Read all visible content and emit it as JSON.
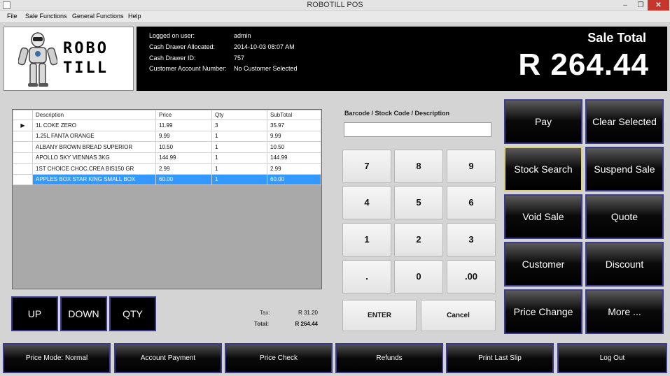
{
  "window": {
    "title": "ROBOTILL POS",
    "minimize": "–",
    "maximize": "❐",
    "close": "✕"
  },
  "menu": [
    "File",
    "Sale Functions",
    "General Functions",
    "Help"
  ],
  "logo": {
    "line1": "ROBO",
    "line2": "TILL"
  },
  "session": {
    "user_label": "Logged on user:",
    "user_value": "admin",
    "drawer_label": "Cash Drawer Allocated:",
    "drawer_value": "2014-10-03 08:07 AM",
    "drawer_id_label": "Cash Drawer ID:",
    "drawer_id_value": "757",
    "account_label": "Customer Account Number:",
    "account_value": "No Customer Selected"
  },
  "sale": {
    "label": "Sale Total",
    "total": "R 264.44"
  },
  "grid": {
    "columns": [
      "Description",
      "Price",
      "Qty",
      "SubTotal"
    ],
    "current_row_marker": "▶",
    "rows": [
      {
        "description": "1L COKE ZERO",
        "price": "11.99",
        "qty": "3",
        "subtotal": "35.97"
      },
      {
        "description": "1.25L FANTA ORANGE",
        "price": "9.99",
        "qty": "1",
        "subtotal": "9.99"
      },
      {
        "description": "ALBANY BROWN BREAD SUPERIOR",
        "price": "10.50",
        "qty": "1",
        "subtotal": "10.50"
      },
      {
        "description": "APOLLO SKY VIENNAS 3KG",
        "price": "144.99",
        "qty": "1",
        "subtotal": "144.99"
      },
      {
        "description": "1ST CHOICE CHOC.CREA BIS150 GR",
        "price": "2.99",
        "qty": "1",
        "subtotal": "2.99"
      },
      {
        "description": "APPLES BOX STAR KING SMALL BOX",
        "price": "60.00",
        "qty": "1",
        "subtotal": "60.00"
      }
    ]
  },
  "grid_buttons": {
    "up": "UP",
    "down": "DOWN",
    "qty": "QTY"
  },
  "totals": {
    "tax_label": "Tax:",
    "tax_value": "R 31.20",
    "total_label": "Total:",
    "total_value": "R 264.44"
  },
  "entry": {
    "label": "Barcode / Stock Code / Description",
    "value": ""
  },
  "keypad": [
    "7",
    "8",
    "9",
    "4",
    "5",
    "6",
    "1",
    "2",
    "3",
    ".",
    "0",
    ".00"
  ],
  "keypad_actions": {
    "enter": "ENTER",
    "cancel": "Cancel"
  },
  "functions": [
    "Pay",
    "Clear Selected",
    "Stock Search",
    "Suspend Sale",
    "Void Sale",
    "Quote",
    "Customer",
    "Discount",
    "Price Change",
    "More ..."
  ],
  "bottom_bar": [
    "Price Mode: Normal",
    "Account Payment",
    "Price Check",
    "Refunds",
    "Print Last Slip",
    "Log Out"
  ]
}
